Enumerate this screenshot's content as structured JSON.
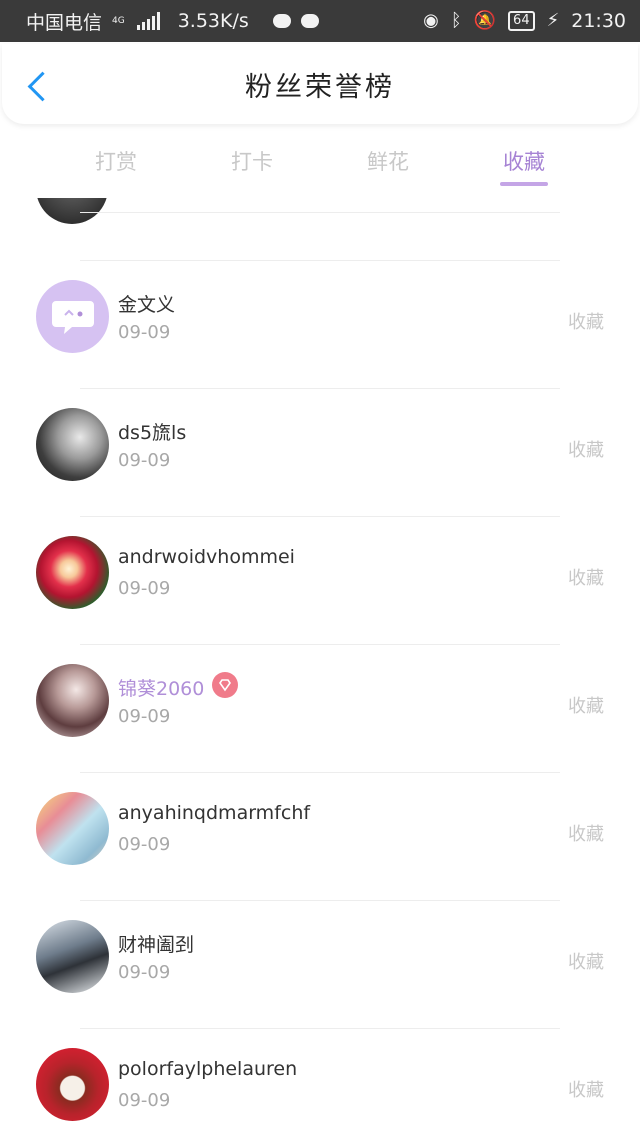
{
  "status_bar": {
    "carrier": "中国电信",
    "network": "4G",
    "speed": "3.53K/s",
    "battery": "64",
    "time": "21:30",
    "icons": [
      "signal-icon",
      "wechat-icon",
      "message-icon",
      "eye-icon",
      "bluetooth-icon",
      "mute-icon",
      "battery-icon",
      "charging-icon"
    ]
  },
  "header": {
    "title": "粉丝荣誉榜",
    "back_icon": "chevron-left-icon",
    "accent_color": "#2196f3"
  },
  "tabs": [
    {
      "label": "打赏",
      "active": false
    },
    {
      "label": "打卡",
      "active": false
    },
    {
      "label": "鲜花",
      "active": false
    },
    {
      "label": "收藏",
      "active": true
    }
  ],
  "tab_active_color": "#a683d4",
  "list": {
    "items": [
      {
        "name": "金文义",
        "date": "09-09",
        "action": "收藏",
        "vip": false
      },
      {
        "name": "ds5旒ls",
        "date": "09-09",
        "action": "收藏",
        "vip": false
      },
      {
        "name": "andrwoidvhommei",
        "date": "09-09",
        "action": "收藏",
        "vip": false
      },
      {
        "name": "锦葵2060",
        "date": "09-09",
        "action": "收藏",
        "vip": true
      },
      {
        "name": "anyahinqdmarmfchf",
        "date": "09-09",
        "action": "收藏",
        "vip": false
      },
      {
        "name": "财神阖刭",
        "date": "09-09",
        "action": "收藏",
        "vip": false
      },
      {
        "name": "polorfaylphelauren",
        "date": "09-09",
        "action": "收藏",
        "vip": false
      }
    ]
  }
}
